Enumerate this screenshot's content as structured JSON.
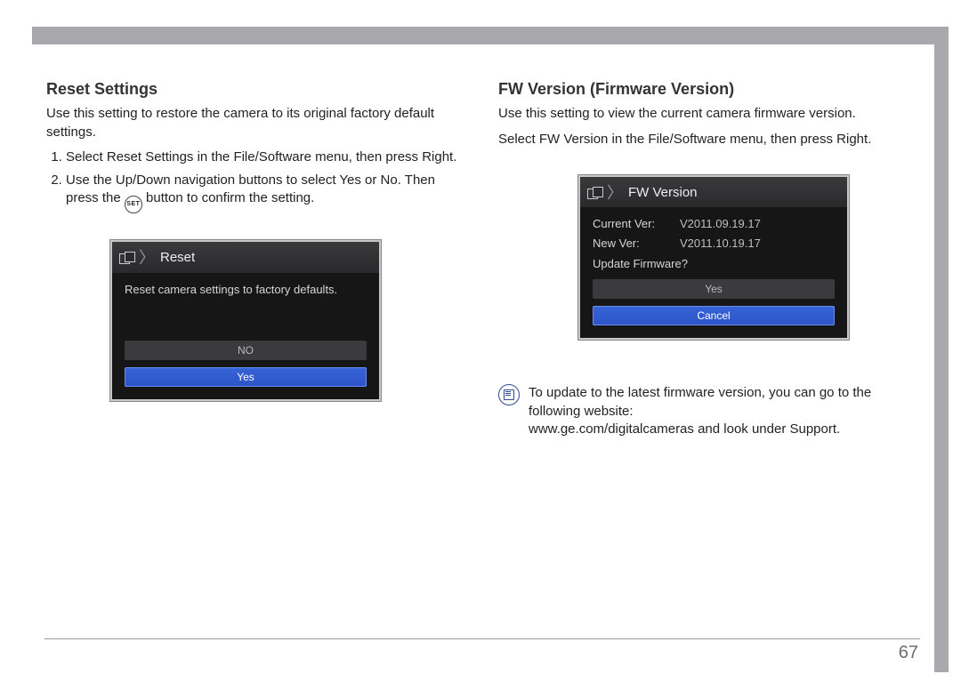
{
  "page_number": "67",
  "left": {
    "heading": "Reset Settings",
    "intro": "Use this setting to restore the camera to its original factory default settings.",
    "steps": [
      "Select Reset Settings in the File/Software menu, then press Right.",
      "Use the Up/Down navigation buttons to select Yes or No. Then press the "
    ],
    "step2_tail": " button to confirm the setting.",
    "set_label": "SET",
    "lcd": {
      "title": "Reset",
      "message": "Reset camera settings to factory defaults.",
      "option_no": "NO",
      "option_yes": "Yes"
    }
  },
  "right": {
    "heading": "FW Version (Firmware Version)",
    "intro": "Use this setting to view the current camera firmware version.",
    "instruction": "Select FW Version in the File/Software menu, then press Right.",
    "lcd": {
      "title": "FW Version",
      "current_label": "Current Ver:",
      "current_value": "V2011.09.19.17",
      "new_label": "New Ver:",
      "new_value": "V2011.10.19.17",
      "prompt": "Update Firmware?",
      "option_yes": "Yes",
      "option_cancel": "Cancel"
    },
    "note": "To update to the latest firmware version, you can go to the following website:",
    "note_url": "www.ge.com/digitalcameras and look under Support."
  }
}
